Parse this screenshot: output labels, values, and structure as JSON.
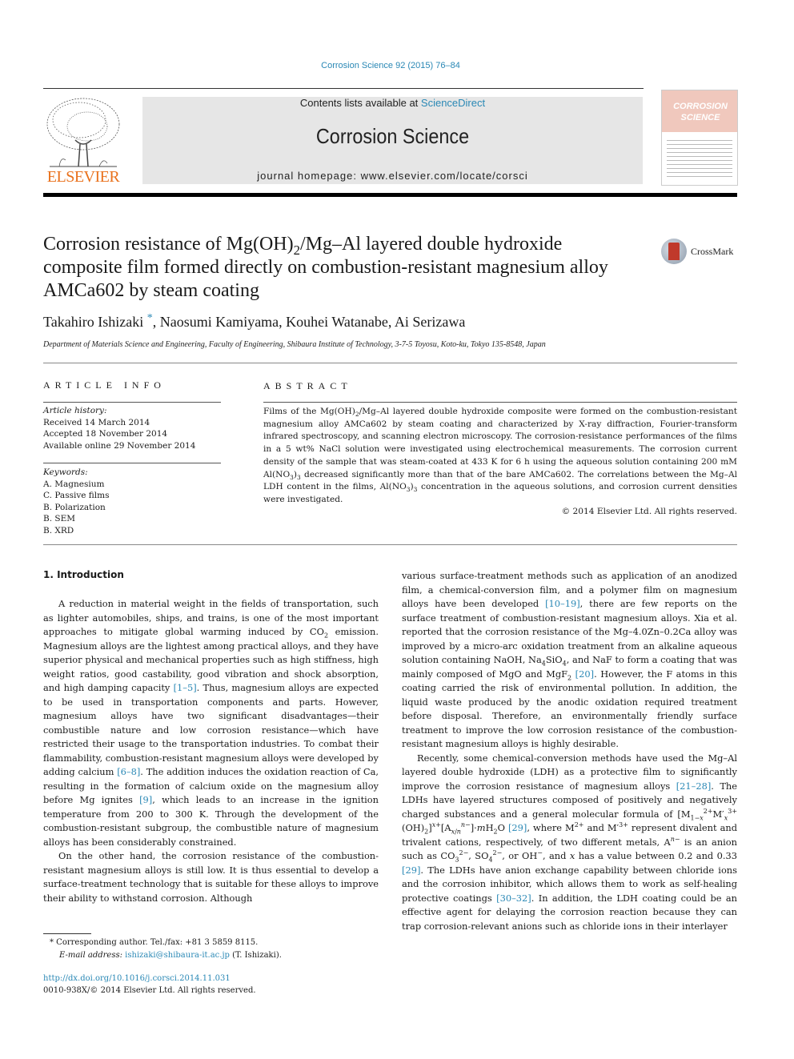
{
  "header": {
    "journal_ref": "Corrosion Science 92 (2015) 76–84",
    "contents_prefix": "Contents lists available at ",
    "contents_link": "ScienceDirect",
    "journal_name": "Corrosion Science",
    "homepage": "journal homepage: www.elsevier.com/locate/corsci",
    "publisher_logo_text": "ELSEVIER",
    "cover_title_1": "CORROSION",
    "cover_title_2": "SCIENCE"
  },
  "article": {
    "title_part1": "Corrosion resistance of Mg(OH)",
    "title_sub": "2",
    "title_part2": "/Mg–Al layered double hydroxide composite film formed directly on combustion-resistant magnesium alloy AMCa602 by steam coating",
    "crossmark_label": "CrossMark",
    "author_1": "Takahiro Ishizaki",
    "author_1_mark": "*",
    "authors_rest": ", Naosumi Kamiyama, Kouhei Watanabe, Ai Serizawa",
    "affiliation": "Department of Materials Science and Engineering, Faculty of Engineering, Shibaura Institute of Technology, 3-7-5 Toyosu, Koto-ku, Tokyo 135-8548, Japan"
  },
  "article_info": {
    "heading": "ARTICLE INFO",
    "history_label": "Article history:",
    "history": [
      "Received 14 March 2014",
      "Accepted 18 November 2014",
      "Available online 29 November 2014"
    ],
    "keywords_label": "Keywords:",
    "keywords": [
      "A. Magnesium",
      "C. Passive films",
      "B. Polarization",
      "B. SEM",
      "B. XRD"
    ]
  },
  "abstract": {
    "heading": "ABSTRACT",
    "text_1": "Films of the Mg(OH)",
    "text_2": "/Mg–Al layered double hydroxide composite were formed on the combustion-resistant magnesium alloy AMCa602 by steam coating and characterized by X-ray diffraction, Fourier-transform infrared spectroscopy, and scanning electron microscopy. The corrosion-resistance performances of the films in a 5 wt% NaCl solution were investigated using electrochemical measurements. The corrosion current density of the sample that was steam-coated at 433 K for 6 h using the aqueous solution containing 200 mM Al(NO",
    "text_3": ")",
    "text_4": " decreased significantly more than that of the bare AMCa602. The correlations between the Mg–Al LDH content in the films, Al(NO",
    "text_5": " concentration in the aqueous solutions, and corrosion current densities were investigated.",
    "copyright": "© 2014 Elsevier Ltd. All rights reserved."
  },
  "intro": {
    "heading": "1. Introduction",
    "p1_a": "A reduction in material weight in the fields of transportation, such as lighter automobiles, ships, and trains, is one of the most important approaches to mitigate global warming induced by CO",
    "p1_b": " emission. Magnesium alloys are the lightest among practical alloys, and they have superior physical and mechanical properties such as high stiffness, high weight ratios, good castability, good vibration and shock absorption, and high damping capacity ",
    "p1_cite1": "[1–5]",
    "p1_c": ". Thus, magnesium alloys are expected to be used in transportation components and parts. However, magnesium alloys have two significant disadvantages—their combustible nature and low corrosion resistance—which have restricted their usage to the transportation industries. To combat their flammability, combustion-resistant magnesium alloys were developed by adding calcium ",
    "p1_cite2": "[6–8]",
    "p1_d": ". The addition induces the oxidation reaction of Ca, resulting in the formation of calcium oxide on the magnesium alloy before Mg ignites ",
    "p1_cite3": "[9]",
    "p1_e": ", which leads to an increase in the ignition temperature from 200 to 300 K. Through the development of the combustion-resistant subgroup, the combustible nature of magnesium alloys has been considerably constrained.",
    "p2": "On the other hand, the corrosion resistance of the combustion-resistant magnesium alloys is still low. It is thus essential to develop a surface-treatment technology that is suitable for these alloys to improve their ability to withstand corrosion. Although",
    "r1_a": "various surface-treatment methods such as application of an anodized film, a chemical-conversion film, and a polymer film on magnesium alloys have been developed ",
    "r1_cite1": "[10–19]",
    "r1_b": ", there are few reports on the surface treatment of combustion-resistant magnesium alloys. Xia et al. reported that the corrosion resistance of the Mg–4.0Zn–0.2Ca alloy was improved by a micro-arc oxidation treatment from an alkaline aqueous solution containing NaOH, Na",
    "r1_c": "SiO",
    "r1_d": ", and NaF to form a coating that was mainly composed of MgO and MgF",
    "r1_cite2": "[20]",
    "r1_e": ". However, the F atoms in this coating carried the risk of environmental pollution. In addition, the liquid waste produced by the anodic oxidation required treatment before disposal. Therefore, an environmentally friendly surface treatment to improve the low corrosion resistance of the combustion-resistant magnesium alloys is highly desirable.",
    "r2_a": "Recently, some chemical-conversion methods have used the Mg–Al layered double hydroxide (LDH) as a protective film to significantly improve the corrosion resistance of magnesium alloys ",
    "r2_cite1": "[21–28]",
    "r2_b": ". The LDHs have layered structures composed of positively and negatively charged substances and a general molecular formula of [M",
    "r2_cite2": "[29]",
    "r2_c": ", where M",
    "r2_d": " and M′",
    "r2_e": " represent divalent and trivalent cations, respectively, of two different metals, A",
    "r2_f": " is an anion such as CO",
    "r2_g": ", SO",
    "r2_h": ", or OH",
    "r2_i": ", and ",
    "r2_x": "x",
    "r2_j": " has a value between 0.2 and 0.33 ",
    "r2_cite3": "[29]",
    "r2_k": ". The LDHs have anion exchange capability between chloride ions and the corrosion inhibitor, which allows them to work as self-healing protective coatings ",
    "r2_cite4": "[30–32]",
    "r2_l": ". In addition, the LDH coating could be an effective agent for delaying the corrosion reaction because they can trap corrosion-relevant anions such as chloride ions in their interlayer"
  },
  "footnote": {
    "mark": "*",
    "text": " Corresponding author. Tel./fax: +81 3 5859 8115.",
    "email_label": "E-mail address: ",
    "email": "ishizaki@shibaura-it.ac.jp",
    "email_suffix": " (T. Ishizaki).",
    "doi": "http://dx.doi.org/10.1016/j.corsci.2014.11.031",
    "issn": "0010-938X/© 2014 Elsevier Ltd. All rights reserved."
  },
  "colors": {
    "link": "#2a88b5",
    "elsevier_orange": "#e9711c",
    "masthead_gray": "#e6e6e6"
  }
}
